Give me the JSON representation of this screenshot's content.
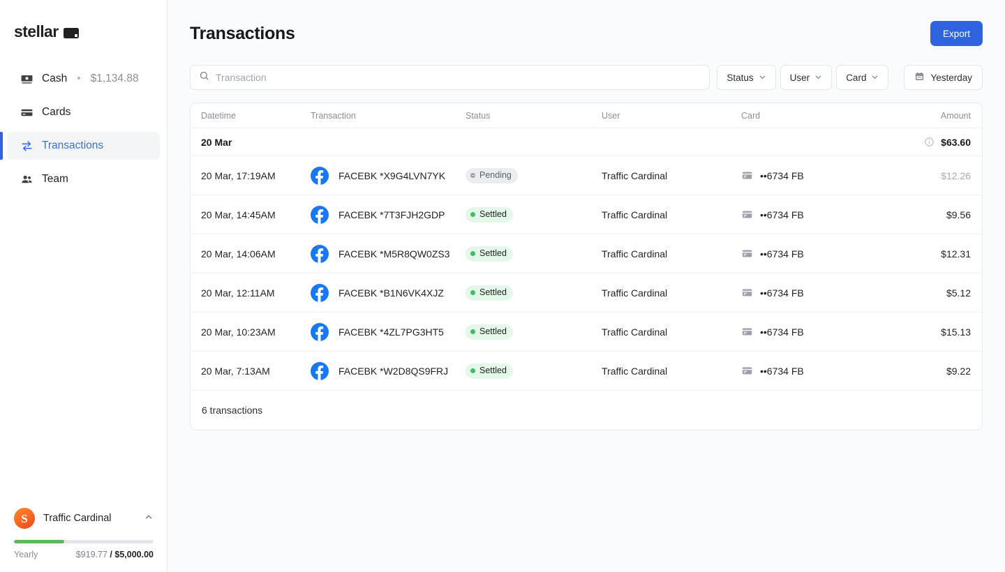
{
  "sidebar": {
    "logo": {
      "text": "stellar",
      "icon": "card-icon"
    },
    "items": [
      {
        "id": "cash",
        "label": "Cash",
        "separator": "•",
        "value": "$1,134.88",
        "icon": "banknote-icon",
        "active": false
      },
      {
        "id": "cards",
        "label": "Cards",
        "icon": "credit-card-icon",
        "active": false
      },
      {
        "id": "transactions",
        "label": "Transactions",
        "icon": "transfer-arrows-icon",
        "active": true
      },
      {
        "id": "team",
        "label": "Team",
        "icon": "people-icon",
        "active": false
      }
    ],
    "account": {
      "name": "Traffic Cardinal",
      "avatar_letter": "S",
      "chevron": "chevron-up-icon",
      "limit_label": "Yearly",
      "limit_used": "$919.77",
      "limit_separator": "/",
      "limit_total": "$5,000.00",
      "progress_percent": 36
    }
  },
  "header": {
    "title": "Transactions",
    "export_label": "Export"
  },
  "toolbar": {
    "search": {
      "placeholder": "Transaction",
      "value": "",
      "icon": "search-icon"
    },
    "filters": [
      {
        "id": "status",
        "label": "Status",
        "icon": "chevron-down-icon"
      },
      {
        "id": "user",
        "label": "User",
        "icon": "chevron-down-icon"
      },
      {
        "id": "card",
        "label": "Card",
        "icon": "chevron-down-icon"
      }
    ],
    "date_filter": {
      "label": "Yesterday",
      "icon": "calendar-icon"
    }
  },
  "table": {
    "columns": {
      "datetime": "Datetime",
      "transaction": "Transaction",
      "status": "Status",
      "user": "User",
      "card": "Card",
      "amount": "Amount"
    },
    "group": {
      "date": "20 Mar",
      "total": "$63.60",
      "info_icon": "info-icon"
    },
    "rows": [
      {
        "datetime": "20 Mar, 17:19AM",
        "merchant_icon": "facebook-icon",
        "transaction": "FACEBK *X9G4LVN7YK",
        "status": "Pending",
        "status_kind": "pending",
        "user": "Traffic Cardinal",
        "card": "••6734 FB",
        "amount": "$12.26",
        "amount_muted": true
      },
      {
        "datetime": "20 Mar, 14:45AM",
        "merchant_icon": "facebook-icon",
        "transaction": "FACEBK *7T3FJH2GDP",
        "status": "Settled",
        "status_kind": "settled",
        "user": "Traffic Cardinal",
        "card": "••6734 FB",
        "amount": "$9.56",
        "amount_muted": false
      },
      {
        "datetime": "20 Mar, 14:06AM",
        "merchant_icon": "facebook-icon",
        "transaction": "FACEBK *M5R8QW0ZS3",
        "status": "Settled",
        "status_kind": "settled",
        "user": "Traffic Cardinal",
        "card": "••6734 FB",
        "amount": "$12.31",
        "amount_muted": false
      },
      {
        "datetime": "20 Mar, 12:11AM",
        "merchant_icon": "facebook-icon",
        "transaction": "FACEBK *B1N6VK4XJZ",
        "status": "Settled",
        "status_kind": "settled",
        "user": "Traffic Cardinal",
        "card": "••6734 FB",
        "amount": "$5.12",
        "amount_muted": false
      },
      {
        "datetime": "20 Mar, 10:23AM",
        "merchant_icon": "facebook-icon",
        "transaction": "FACEBK *4ZL7PG3HT5",
        "status": "Settled",
        "status_kind": "settled",
        "user": "Traffic Cardinal",
        "card": "••6734 FB",
        "amount": "$15.13",
        "amount_muted": false
      },
      {
        "datetime": "20 Mar, 7:13AM",
        "merchant_icon": "facebook-icon",
        "transaction": "FACEBK *W2D8QS9FRJ",
        "status": "Settled",
        "status_kind": "settled",
        "user": "Traffic Cardinal",
        "card": "••6734 FB",
        "amount": "$9.22",
        "amount_muted": false
      }
    ],
    "footer": "6 transactions"
  },
  "colors": {
    "accent_blue": "#2f63e0",
    "facebook_blue": "#1877f2",
    "settled_green": "#3fbf5e",
    "settled_bg": "#e3f8e9",
    "pending_bg": "#ebedf0",
    "progress_green": "#5cb85c",
    "avatar_orange": "#f4451f",
    "page_bg": "#fafbfc"
  }
}
